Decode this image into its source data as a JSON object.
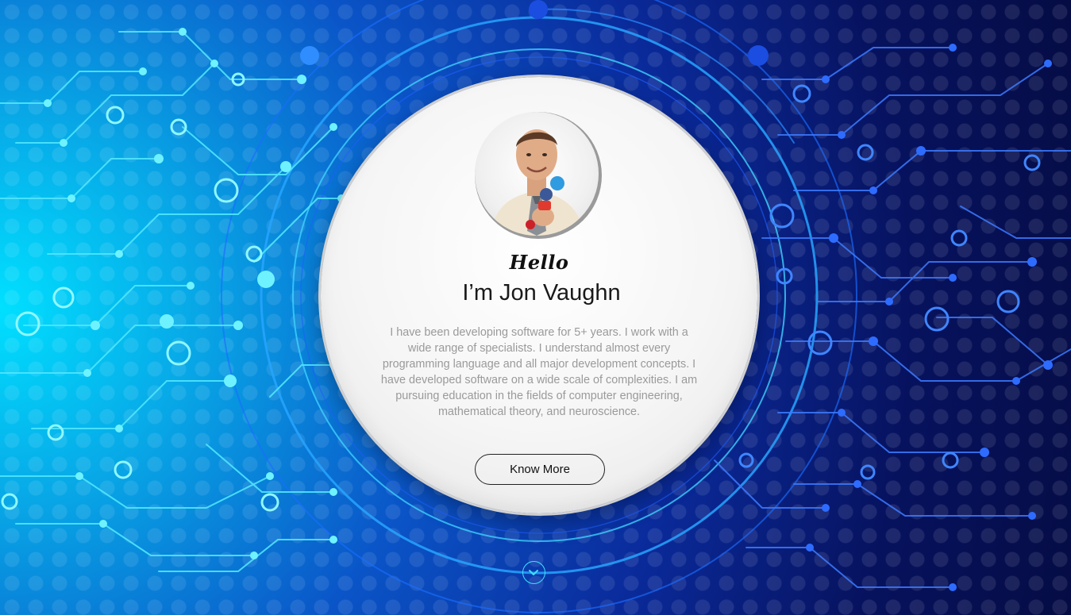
{
  "hero": {
    "greeting": "Hello",
    "name": "I’m Jon Vaughn",
    "bio": "I have been developing software for 5+ years. I work with a wide range of specialists. I understand almost every programming language and all major development concepts. I have developed software on a wide scale of complexities. I am pursuing education in the fields of computer engineering, mathematical theory, and neuroscience.",
    "cta_label": "Know More",
    "avatar_alt": "Profile photo of Jon Vaughn"
  },
  "icons": {
    "scroll": "chevron-down-icon"
  },
  "colors": {
    "background_glow": "#00e0ff",
    "background_deep": "#050c44",
    "circuit_line": "#2ad0ff",
    "card": "#f5f5f5",
    "bio_text": "#9a9a9a"
  }
}
